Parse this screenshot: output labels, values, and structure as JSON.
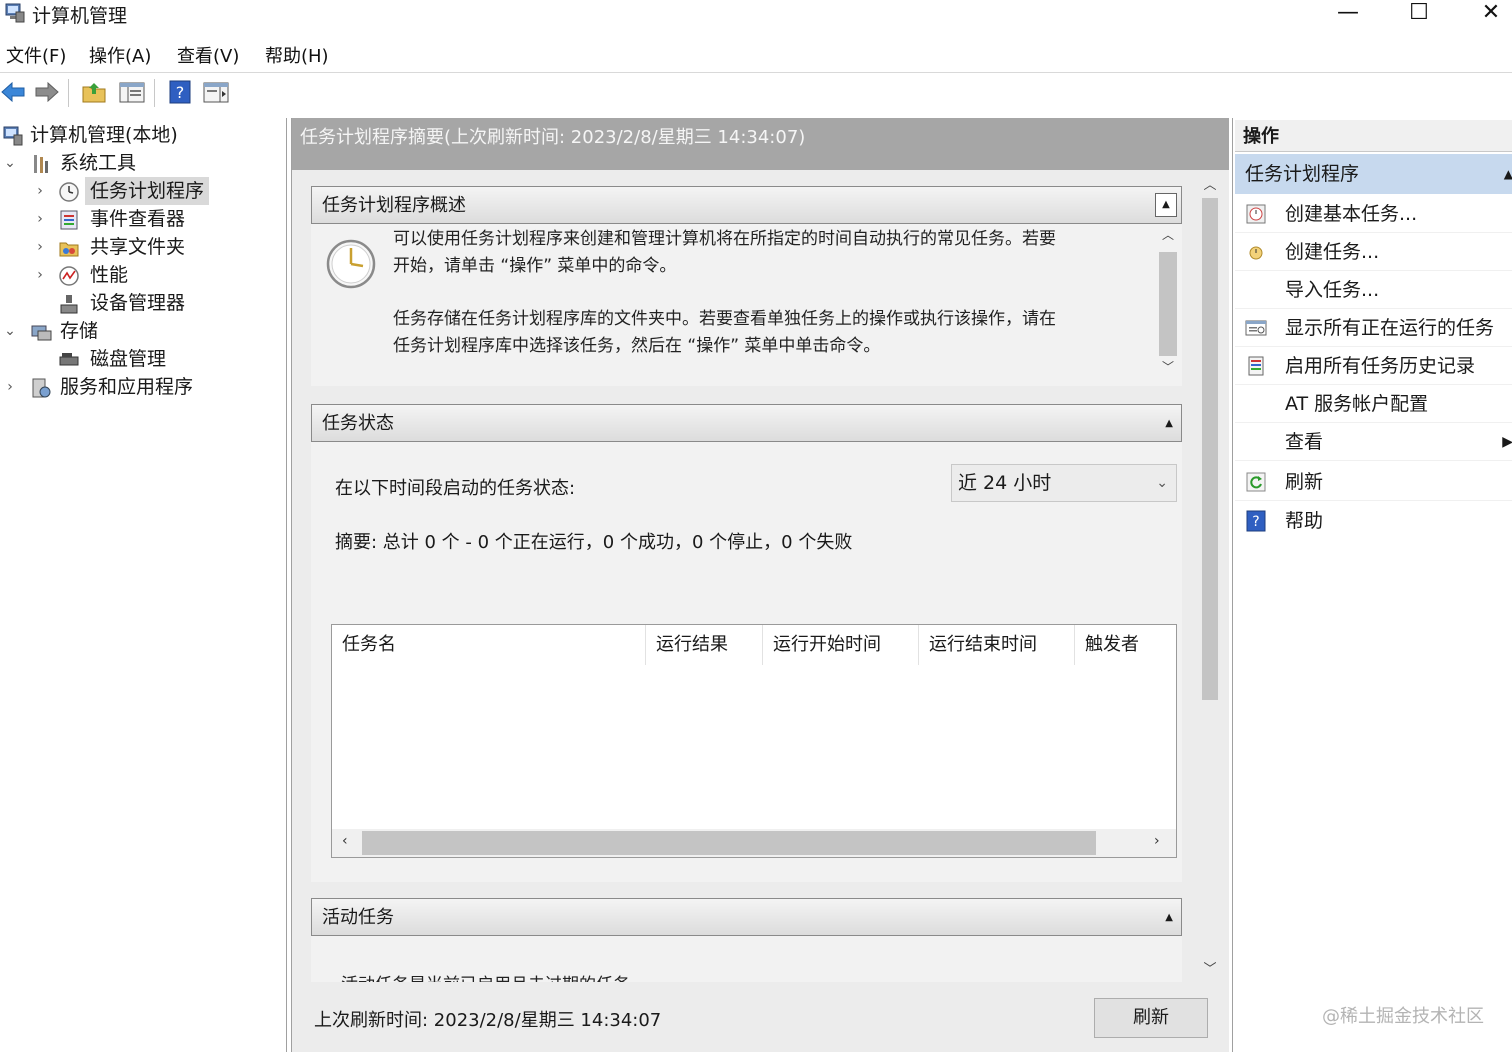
{
  "window": {
    "title": "计算机管理",
    "minimize": "—",
    "maximize": "☐",
    "close": "✕"
  },
  "menu": {
    "file": "文件(F)",
    "action": "操作(A)",
    "view": "查看(V)",
    "help": "帮助(H)"
  },
  "tree": {
    "root": "计算机管理(本地)",
    "system_tools": "系统工具",
    "task_scheduler": "任务计划程序",
    "event_viewer": "事件查看器",
    "shared_folders": "共享文件夹",
    "performance": "性能",
    "device_manager": "设备管理器",
    "storage": "存储",
    "disk_management": "磁盘管理",
    "services_apps": "服务和应用程序"
  },
  "center": {
    "header": "任务计划程序摘要(上次刷新时间: 2023/2/8/星期三 14:34:07)",
    "overview": {
      "title": "任务计划程序概述",
      "p1_line1": "可以使用任务计划程序来创建和管理计算机将在所指定的时间自动执行的常见任务。若要",
      "p1_line2": "开始，请单击 “操作” 菜单中的命令。",
      "p2_line1": "任务存储在任务计划程序库的文件夹中。若要查看单独任务上的操作或执行该操作，请在",
      "p2_line2": "任务计划程序库中选择该任务，然后在 “操作” 菜单中单击命令。"
    },
    "status": {
      "title": "任务状态",
      "period_label": "在以下时间段启动的任务状态:",
      "period_value": "近 24 小时",
      "summary": "摘要: 总计 0 个 - 0 个正在运行，0 个成功，0 个停止，0 个失败",
      "columns": [
        "任务名",
        "运行结果",
        "运行开始时间",
        "运行结束时间",
        "触发者"
      ]
    },
    "active": {
      "title": "活动任务",
      "partial": "活动任务是当前已启用且未过期的任务。"
    },
    "footer": {
      "last_refresh": "上次刷新时间: 2023/2/8/星期三 14:34:07",
      "refresh_button": "刷新"
    }
  },
  "actions": {
    "header": "操作",
    "group": "任务计划程序",
    "items": [
      {
        "label": "创建基本任务...",
        "icon": "basic-task-icon"
      },
      {
        "label": "创建任务...",
        "icon": "create-task-icon"
      },
      {
        "label": "导入任务...",
        "icon": ""
      },
      {
        "label": "显示所有正在运行的任务",
        "icon": "running-tasks-icon"
      },
      {
        "label": "启用所有任务历史记录",
        "icon": "history-icon"
      },
      {
        "label": "AT 服务帐户配置",
        "icon": ""
      },
      {
        "label": "查看",
        "icon": ""
      },
      {
        "label": "刷新",
        "icon": "refresh-icon"
      },
      {
        "label": "帮助",
        "icon": "help-icon"
      }
    ]
  },
  "watermark": "@稀土掘金技术社区"
}
